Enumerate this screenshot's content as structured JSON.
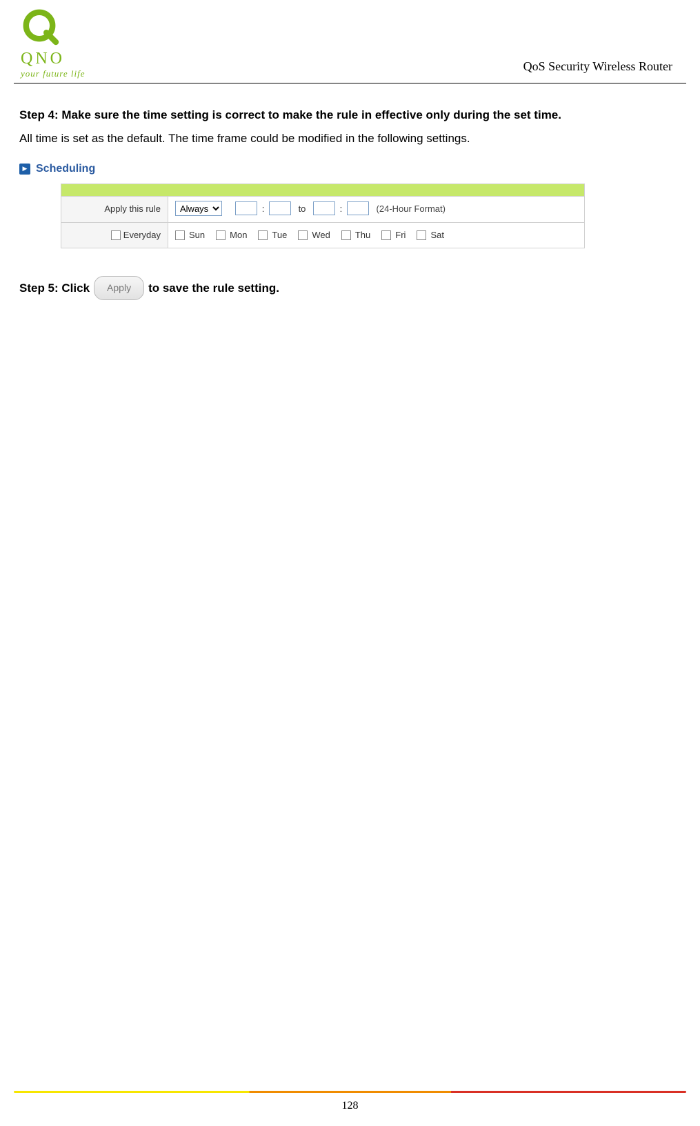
{
  "header": {
    "brand": "QNO",
    "tagline": "your future life",
    "title": "QoS Security Wireless Router"
  },
  "step4": {
    "heading": "Step 4: Make sure the time setting is correct to make the rule in effective only during the set time.",
    "body": "All time is set as the default.   The time frame could be modified in the following settings."
  },
  "scheduling": {
    "title": "Scheduling",
    "apply_label": "Apply this rule",
    "apply_select": "Always",
    "to_label": "to",
    "format_label": "(24-Hour Format)",
    "everyday": "Everyday",
    "days": [
      "Sun",
      "Mon",
      "Tue",
      "Wed",
      "Thu",
      "Fri",
      "Sat"
    ]
  },
  "step5": {
    "prefix": "Step 5: Click",
    "button": "Apply",
    "suffix": "to save the rule setting."
  },
  "page_number": "128"
}
